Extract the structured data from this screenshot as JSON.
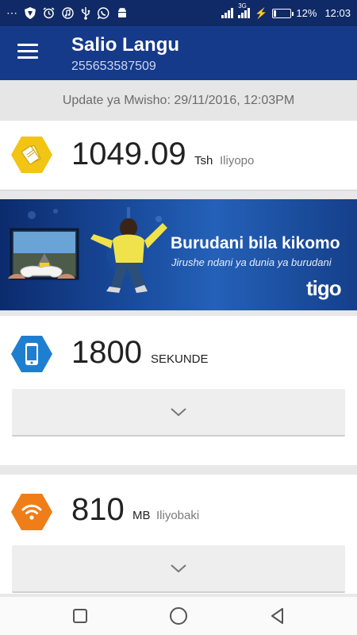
{
  "status_bar": {
    "network_type": "3G",
    "battery_percent": "12%",
    "battery_level": 0.12,
    "time": "12:03",
    "left_icons": [
      "more-icon",
      "shield-icon",
      "alarm-icon",
      "music-icon",
      "usb-icon",
      "whatsapp-icon",
      "android-icon"
    ]
  },
  "app_bar": {
    "title": "Salio Langu",
    "subtitle": "255653587509"
  },
  "update_bar": {
    "text": "Update ya Mwisho: 29/11/2016, 12:03PM"
  },
  "balance": {
    "amount": "1049.09",
    "unit": "Tsh",
    "qualifier": "Iliyopo",
    "icon": "money-icon",
    "color": "#f2c414"
  },
  "banner": {
    "headline": "Burudani bila kikomo",
    "subtext": "Jirushe ndani ya dunia ya burudani",
    "logo": "tigo"
  },
  "seconds": {
    "amount": "1800",
    "unit": "SEKUNDE",
    "icon": "phone-icon",
    "color": "#1e7fd0"
  },
  "data": {
    "amount": "810",
    "unit": "MB",
    "qualifier": "Iliyobaki",
    "icon": "wifi-icon",
    "color": "#ef7d18"
  },
  "nav": {
    "items": [
      "recents-icon",
      "home-icon",
      "back-icon"
    ]
  }
}
